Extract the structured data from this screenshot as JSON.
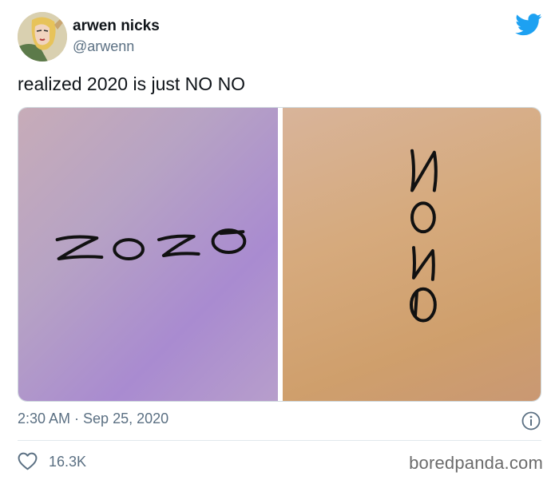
{
  "author": {
    "name": "arwen nicks",
    "handle": "@arwenn"
  },
  "tweet": {
    "text": "realized 2020 is just NO NO",
    "timestamp": "2:30 AM · Sep 25, 2020",
    "likes": "16.3K"
  },
  "media": {
    "left_image_text": "2020",
    "right_image_text": "2020"
  },
  "icons": {
    "brand": "twitter-bird-icon",
    "info": "info-icon",
    "like": "heart-icon"
  },
  "colors": {
    "accent": "#1da1f2",
    "secondary_text": "#5b7083",
    "divider": "#e1e8ed"
  },
  "watermark": "boredpanda.com"
}
